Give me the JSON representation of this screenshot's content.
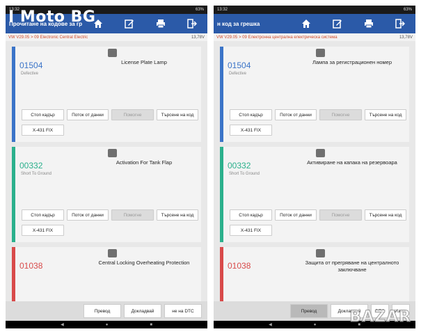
{
  "overlay": {
    "watermark": "I Moto BG",
    "corner_mark": "BAZAR"
  },
  "colors": {
    "topbar": "#2b5aa8",
    "blue": "#3b74c8",
    "green": "#2bb08c",
    "red": "#d84a4a"
  },
  "left": {
    "status": {
      "time": "13:32",
      "battery": "63%"
    },
    "title": "Прочитане на кодове за грешка",
    "breadcrumb": "VW V29.05 > 09 Electronic Central Electric",
    "voltage": "13,78V",
    "cards": [
      {
        "code": "01504",
        "status": "Defective",
        "desc": "License Plate Lamp",
        "color": "#3b74c8"
      },
      {
        "code": "00332",
        "status": "Short To Ground",
        "desc": "Activation For Tank Flap",
        "color": "#2bb08c"
      },
      {
        "code": "01038",
        "status": "",
        "desc": "Central Locking Overheating Protection",
        "color": "#d84a4a"
      }
    ],
    "buttons": {
      "freeze": "Стоп кадър",
      "stream": "Поток от данни",
      "help": "Помогне",
      "search": "Търсене на код",
      "fix": "X-431 FIX"
    },
    "bottom": {
      "translate": "Превод",
      "report": "Докладвай",
      "dtc": "не на DTC"
    }
  },
  "right": {
    "status": {
      "time": "13:32",
      "battery": "63%"
    },
    "title": "н код за грешка",
    "breadcrumb": "VW V29.05 > 09 Електронна централна електрическа система",
    "voltage": "13,78V",
    "cards": [
      {
        "code": "01504",
        "status": "Defective",
        "desc": "Лампа за регистрационен номер",
        "color": "#3b74c8"
      },
      {
        "code": "00332",
        "status": "Short To Ground",
        "desc": "Активиране на капака на резервоара",
        "color": "#2bb08c"
      },
      {
        "code": "01038",
        "status": "",
        "desc": "Защита от прегряване на централното заключване",
        "color": "#d84a4a"
      }
    ],
    "buttons": {
      "freeze": "Стоп кадър",
      "stream": "Поток от данни",
      "help": "Помогне",
      "search": "Търсене на код",
      "fix": "X-431 FIX"
    },
    "bottom": {
      "translate": "Превод",
      "report": "Докладвай",
      "dtc": "DTC",
      "clear": "Изчис"
    }
  }
}
